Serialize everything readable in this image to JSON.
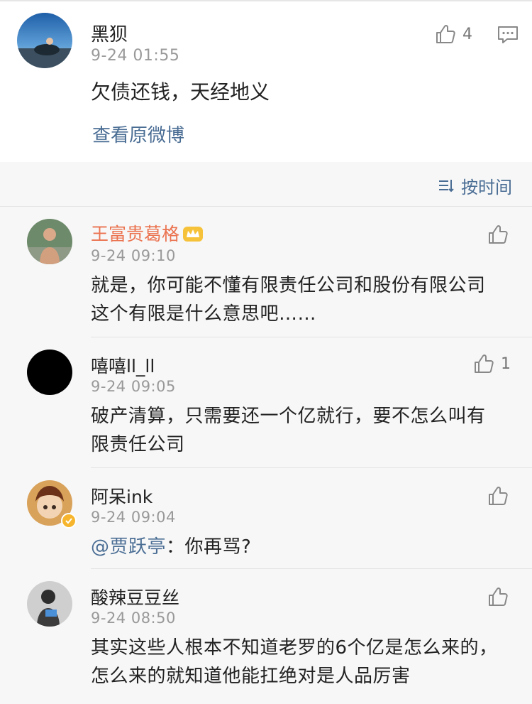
{
  "post": {
    "author": "黑狈",
    "time": "9-24 01:55",
    "text": "欠债还钱，天经地义",
    "view_original": "查看原微博",
    "like_count": "4",
    "like_icon": "thumb-up-icon",
    "comment_icon": "comment-icon"
  },
  "sort": {
    "label": "按时间",
    "icon": "sort-icon"
  },
  "comments": [
    {
      "name": "王富贵葛格",
      "time": "9-24 09:10",
      "text": "就是，你可能不懂有限责任公司和股份有限公司这个有限是什么意思吧……",
      "like_count": "",
      "badge": "crown-icon"
    },
    {
      "name": "嘻嘻ll_ll",
      "time": "9-24 09:05",
      "text": "破产清算，只需要还一个亿就行，要不怎么叫有限责任公司",
      "like_count": "1"
    },
    {
      "name": "阿呆ink",
      "time": "9-24 09:04",
      "mention": "@贾跃亭",
      "text": "：你再骂?",
      "like_count": "",
      "badge": "verified-icon"
    },
    {
      "name": "酸辣豆豆丝",
      "time": "9-24 08:50",
      "text": "其实这些人根本不知道老罗的6个亿是怎么来的，怎么来的就知道他能扛绝对是人品厉害",
      "like_count": ""
    }
  ],
  "colors": {
    "link": "#4a6d94",
    "highlight_name": "#eb7350",
    "meta": "#999999",
    "background": "#f7f7f7"
  }
}
